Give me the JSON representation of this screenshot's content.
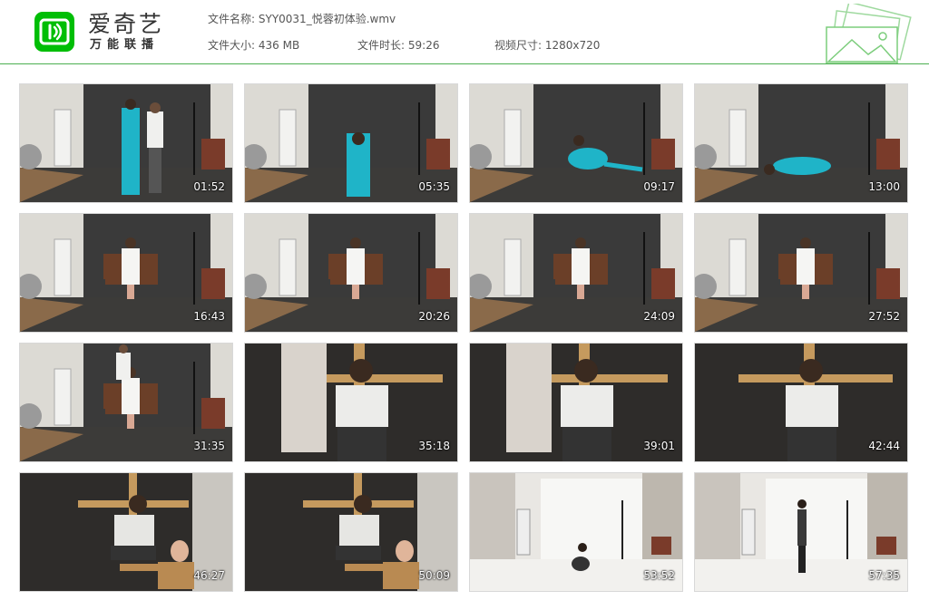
{
  "brand": {
    "name": "爱奇艺",
    "sub": "万能联播"
  },
  "file": {
    "name_label": "文件名称:",
    "name": "SYY0031_悦蓉初体验.wmv",
    "size_label": "文件大小:",
    "size": "436 MB",
    "duration_label": "文件时长:",
    "duration": "59:26",
    "dims_label": "视频尺寸:",
    "dims": "1280x720"
  },
  "colors": {
    "accent": "#00be06",
    "rule": "#4caf50"
  },
  "thumbnails": [
    {
      "time": "01:52",
      "scene": "studio-standing-pair"
    },
    {
      "time": "05:35",
      "scene": "studio-chair"
    },
    {
      "time": "09:17",
      "scene": "studio-floor-sitting"
    },
    {
      "time": "13:00",
      "scene": "studio-floor-lying"
    },
    {
      "time": "16:43",
      "scene": "studio-bench"
    },
    {
      "time": "20:26",
      "scene": "studio-bench"
    },
    {
      "time": "24:09",
      "scene": "studio-bench"
    },
    {
      "time": "27:52",
      "scene": "studio-bench"
    },
    {
      "time": "31:35",
      "scene": "studio-bench-pair"
    },
    {
      "time": "35:18",
      "scene": "cross-closeup-pair"
    },
    {
      "time": "39:01",
      "scene": "cross-closeup-pair"
    },
    {
      "time": "42:44",
      "scene": "cross-closeup"
    },
    {
      "time": "46:27",
      "scene": "cross-wide"
    },
    {
      "time": "50:09",
      "scene": "cross-wide"
    },
    {
      "time": "53:52",
      "scene": "white-studio-crouch"
    },
    {
      "time": "57:35",
      "scene": "white-studio-stand"
    }
  ]
}
